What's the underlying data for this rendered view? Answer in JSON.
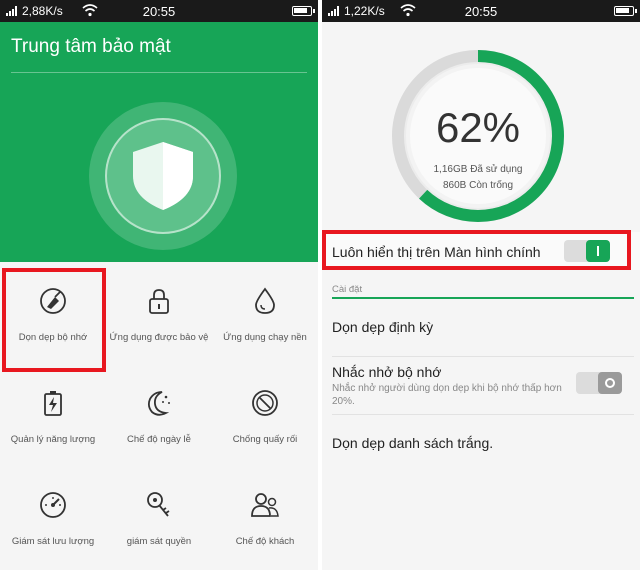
{
  "left": {
    "status": {
      "speed": "2,88K/s",
      "time": "20:55"
    },
    "header": {
      "title": "Trung tâm bảo mật"
    },
    "tiles": [
      {
        "label": "Dọn dẹp bộ nhớ",
        "icon": "broom-cleanup-icon"
      },
      {
        "label": "Ứng dụng được bảo vệ",
        "icon": "lock-icon"
      },
      {
        "label": "Ứng dụng chạy nền",
        "icon": "droplet-icon"
      },
      {
        "label": "Quản lý năng lượng",
        "icon": "battery-icon"
      },
      {
        "label": "Chế độ ngày lễ",
        "icon": "moon-stars-icon"
      },
      {
        "label": "Chống quấy rối",
        "icon": "block-icon"
      },
      {
        "label": "Giám sát lưu lượng",
        "icon": "speedometer-icon"
      },
      {
        "label": "giám sát quyền",
        "icon": "key-icon"
      },
      {
        "label": "Chế độ khách",
        "icon": "guest-users-icon"
      }
    ]
  },
  "right": {
    "status": {
      "speed": "1,22K/s",
      "time": "20:55"
    },
    "memory": {
      "percent_label": "62%",
      "percent": 62,
      "used": "1,16GB Đã sử dụng",
      "free": "860B Còn trống"
    },
    "always_show": {
      "label": "Luôn hiển thị trên Màn hình chính",
      "enabled": true
    },
    "section": "Cài đặt",
    "periodic": {
      "label": "Dọn dẹp định kỳ"
    },
    "reminder": {
      "label": "Nhắc nhở bộ nhớ",
      "description": "Nhắc nhở người dùng dọn dẹp khi bộ nhớ thấp hơn 20%.",
      "enabled": false
    },
    "whitelist": {
      "label": "Dọn dẹp danh sách trắng."
    }
  },
  "colors": {
    "accent": "#17a557",
    "highlight": "#e8171f"
  }
}
